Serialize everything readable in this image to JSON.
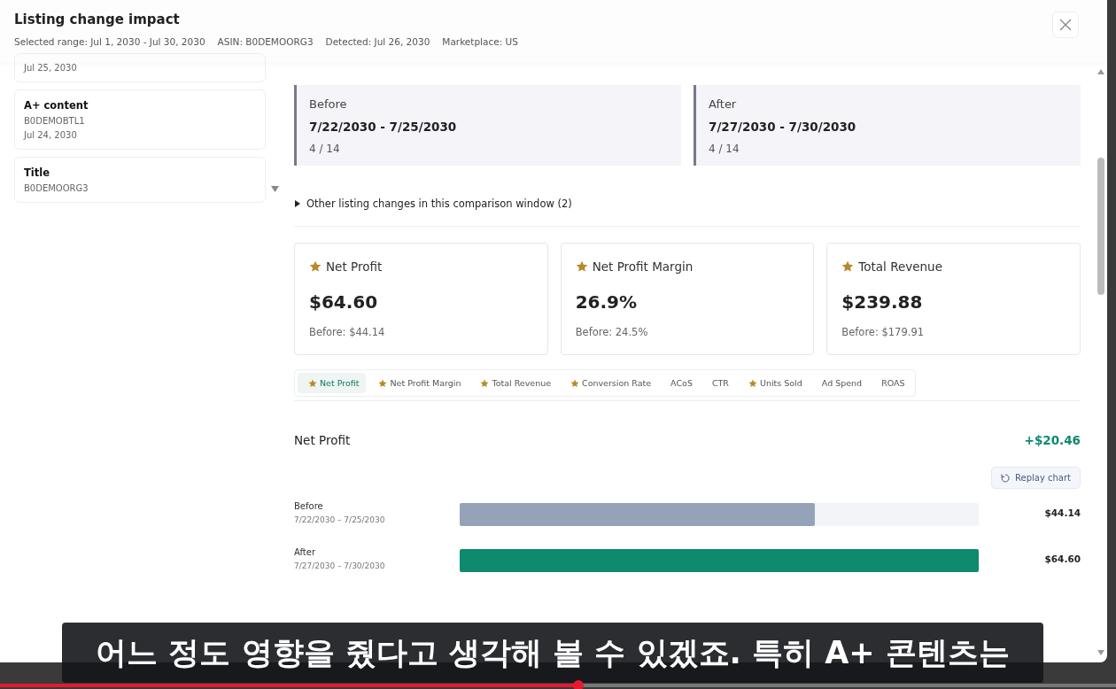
{
  "modal": {
    "title": "Listing change impact",
    "meta": [
      "Selected range: Jul 1, 2030 - Jul 30, 2030",
      "ASIN: B0DEMOORG3",
      "Detected: Jul 26, 2030",
      "Marketplace: US"
    ]
  },
  "sidebar": {
    "items": [
      {
        "date": "Jul 25, 2030"
      },
      {
        "title": "A+ content",
        "asin": "B0DEMOBTL1",
        "date": "Jul 24, 2030"
      },
      {
        "title": "Title",
        "asin": "B0DEMOORG3"
      }
    ]
  },
  "windows": [
    {
      "label": "Before",
      "range": "7/22/2030 - 7/25/2030",
      "coverage": "4 / 14"
    },
    {
      "label": "After",
      "range": "7/27/2030 - 7/30/2030",
      "coverage": "4 / 14"
    }
  ],
  "other_changes": {
    "label": "Other listing changes in this comparison window (2)",
    "expanded": false
  },
  "kpis": [
    {
      "label": "Net Profit",
      "starred": true,
      "value": "$64.60",
      "before": "Before: $44.14"
    },
    {
      "label": "Net Profit Margin",
      "starred": true,
      "value": "26.9%",
      "before": "Before: 24.5%"
    },
    {
      "label": "Total Revenue",
      "starred": true,
      "value": "$239.88",
      "before": "Before: $179.91"
    }
  ],
  "metric_tabs": [
    {
      "label": "Net Profit",
      "starred": true,
      "selected": true
    },
    {
      "label": "Net Profit Margin",
      "starred": true,
      "selected": false
    },
    {
      "label": "Total Revenue",
      "starred": true,
      "selected": false
    },
    {
      "label": "Conversion Rate",
      "starred": true,
      "selected": false
    },
    {
      "label": "ACoS",
      "starred": false,
      "selected": false
    },
    {
      "label": "CTR",
      "starred": false,
      "selected": false
    },
    {
      "label": "Units Sold",
      "starred": true,
      "selected": false
    },
    {
      "label": "Ad Spend",
      "starred": false,
      "selected": false
    },
    {
      "label": "ROAS",
      "starred": false,
      "selected": false
    }
  ],
  "comparison": {
    "title": "Net Profit",
    "delta": "+$20.46",
    "replay_button": "Replay chart",
    "rows": [
      {
        "kind": "before",
        "label": "Before",
        "range": "7/22/2030 – 7/25/2030",
        "level": 0.684,
        "value": "$44.14"
      },
      {
        "kind": "after",
        "label": "After",
        "range": "7/27/2030 – 7/30/2030",
        "level": 1,
        "value": "$64.60"
      }
    ]
  },
  "subtitle": "어느 정도 영향을 줬다고 생각해 볼 수 있겠죠. 특히 A+ 콘텐츠는",
  "playback": {
    "level": 0.518
  }
}
